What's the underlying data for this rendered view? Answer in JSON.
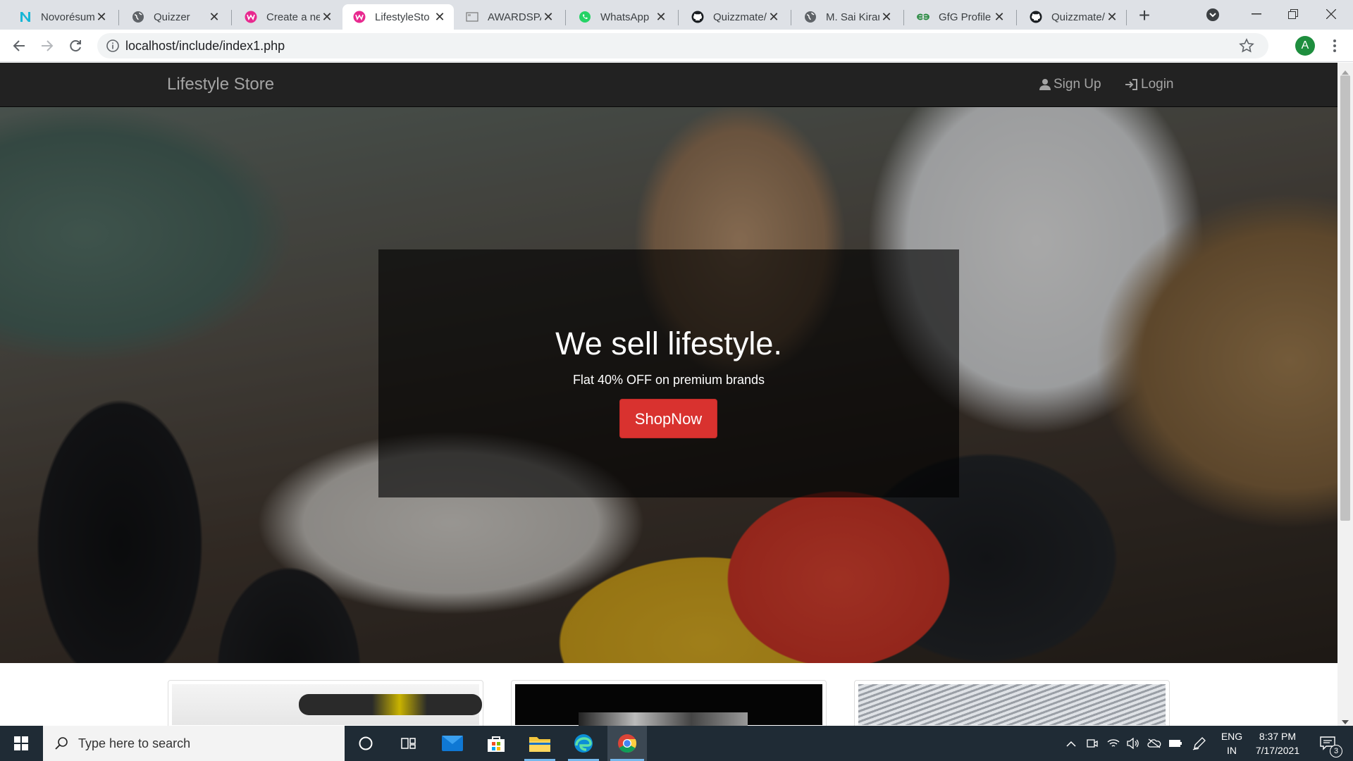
{
  "browser": {
    "tabs": [
      {
        "title": "Novorésum",
        "icon": "novoresume-icon",
        "active": false
      },
      {
        "title": "Quizzer",
        "icon": "globe-icon",
        "active": false
      },
      {
        "title": "Create a ne",
        "icon": "webflow-icon",
        "active": false
      },
      {
        "title": "LifestyleSto",
        "icon": "webflow-icon",
        "active": true
      },
      {
        "title": "AWARDSPA",
        "icon": "awardspace-icon",
        "active": false
      },
      {
        "title": "WhatsApp",
        "icon": "whatsapp-icon",
        "active": false
      },
      {
        "title": "Quizzmate/",
        "icon": "github-icon",
        "active": false
      },
      {
        "title": "M. Sai Kiran",
        "icon": "globe-icon",
        "active": false
      },
      {
        "title": "GfG Profile",
        "icon": "gfg-icon",
        "active": false
      },
      {
        "title": "Quizzmate/",
        "icon": "github-icon",
        "active": false
      }
    ],
    "close_glyph": "✕",
    "new_tab_glyph": "+",
    "url": "localhost/include/index1.php",
    "profile_initial": "A"
  },
  "page": {
    "brand": "Lifestyle Store",
    "nav": {
      "signup": "Sign Up",
      "login": "Login"
    },
    "hero": {
      "heading": "We sell lifestyle.",
      "subheading": "Flat 40% OFF on premium brands",
      "button": "ShopNow"
    }
  },
  "taskbar": {
    "search_placeholder": "Type here to search",
    "language": "ENG",
    "region": "IN",
    "time": "8:37 PM",
    "date": "7/17/2021",
    "notifications": "3"
  },
  "colors": {
    "navbar_bg": "#222222",
    "button_red": "#d9322f",
    "taskbar_bg": "#1f2b35"
  }
}
